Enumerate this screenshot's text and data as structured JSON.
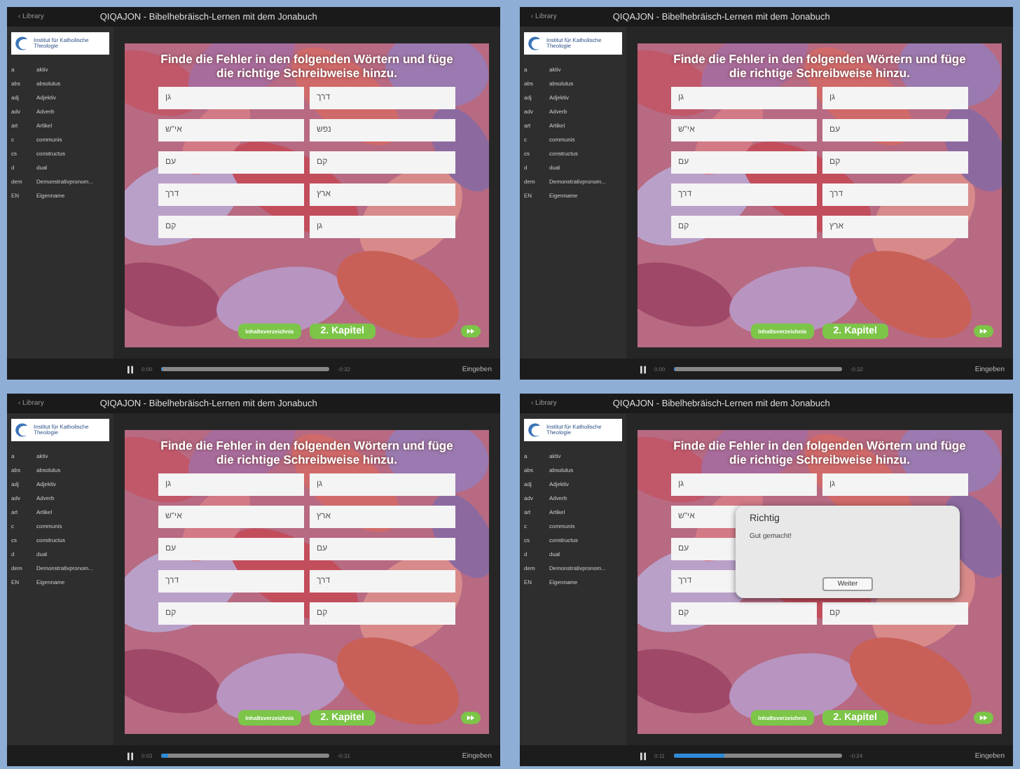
{
  "panels": [
    {
      "back": "‹ Library",
      "title": "QIQAJON - Bibelhebräisch-Lernen mit dem Jonabuch",
      "logo": "Institut für Katholische Theologie",
      "sidebar": [
        {
          "abbr": "a",
          "label": "aktiv"
        },
        {
          "abbr": "abs",
          "label": "absolutus"
        },
        {
          "abbr": "adj",
          "label": "Adjektiv"
        },
        {
          "abbr": "adv",
          "label": "Adverb"
        },
        {
          "abbr": "art",
          "label": "Artikel"
        },
        {
          "abbr": "c",
          "label": "communis"
        },
        {
          "abbr": "cs",
          "label": "constructus"
        },
        {
          "abbr": "d",
          "label": "dual"
        },
        {
          "abbr": "dem",
          "label": "Demonstrativpronom..."
        },
        {
          "abbr": "EN",
          "label": "Eigenname"
        }
      ],
      "heading": "Finde die Fehler in den folgenden Wörtern und füge die richtige Schreibweise hinzu.",
      "rows": [
        {
          "left": "גן",
          "right": "דרך"
        },
        {
          "left": "אי\"ש",
          "right": "נפש"
        },
        {
          "left": "עם",
          "right": "קם"
        },
        {
          "left": "דרך",
          "right": "ארץ"
        },
        {
          "left": "קם",
          "right": "גן"
        }
      ],
      "toc": "Inhaltsverzeichnis",
      "chapter": "2. Kapitel",
      "elapsed": "0:00",
      "remaining": "-0:32",
      "level": 0,
      "enter": "Eingeben"
    },
    {
      "back": "‹ Library",
      "title": "QIQAJON - Bibelhebräisch-Lernen mit dem Jonabuch",
      "logo": "Institut für Katholische Theologie",
      "sidebar": [
        {
          "abbr": "a",
          "label": "aktiv"
        },
        {
          "abbr": "abs",
          "label": "absolutus"
        },
        {
          "abbr": "adj",
          "label": "Adjektiv"
        },
        {
          "abbr": "adv",
          "label": "Adverb"
        },
        {
          "abbr": "art",
          "label": "Artikel"
        },
        {
          "abbr": "c",
          "label": "communis"
        },
        {
          "abbr": "cs",
          "label": "constructus"
        },
        {
          "abbr": "d",
          "label": "dual"
        },
        {
          "abbr": "dem",
          "label": "Demonstrativpronom..."
        },
        {
          "abbr": "EN",
          "label": "Eigenname"
        }
      ],
      "heading": "Finde die Fehler in den folgenden Wörtern und füge die richtige Schreibweise hinzu.",
      "rows": [
        {
          "left": "גן",
          "right": "גן"
        },
        {
          "left": "אי\"ש",
          "right": "עם"
        },
        {
          "left": "עם",
          "right": "קם"
        },
        {
          "left": "דרך",
          "right": "דרך"
        },
        {
          "left": "קם",
          "right": "ארץ"
        }
      ],
      "toc": "Inhaltsverzeichnis",
      "chapter": "2. Kapitel",
      "elapsed": "0:00",
      "remaining": "-0:32",
      "level": 0,
      "enter": "Eingeben"
    },
    {
      "back": "‹ Library",
      "title": "QIQAJON - Bibelhebräisch-Lernen mit dem Jonabuch",
      "logo": "Institut für Katholische Theologie",
      "sidebar": [
        {
          "abbr": "a",
          "label": "aktiv"
        },
        {
          "abbr": "abs",
          "label": "absolutus"
        },
        {
          "abbr": "adj",
          "label": "Adjektiv"
        },
        {
          "abbr": "adv",
          "label": "Adverb"
        },
        {
          "abbr": "art",
          "label": "Artikel"
        },
        {
          "abbr": "c",
          "label": "communis"
        },
        {
          "abbr": "cs",
          "label": "constructus"
        },
        {
          "abbr": "d",
          "label": "dual"
        },
        {
          "abbr": "dem",
          "label": "Demonstrativpronom..."
        },
        {
          "abbr": "EN",
          "label": "Eigenname"
        }
      ],
      "heading": "Finde die Fehler in den folgenden Wörtern und füge die richtige Schreibweise hinzu.",
      "rows": [
        {
          "left": "גן",
          "right": "גן"
        },
        {
          "left": "אי\"ש",
          "right": "ארץ"
        },
        {
          "left": "עם",
          "right": "עם"
        },
        {
          "left": "דרך",
          "right": "דרך"
        },
        {
          "left": "קם",
          "right": "קם"
        }
      ],
      "toc": "Inhaltsverzeichnis",
      "chapter": "2. Kapitel",
      "elapsed": "0:03",
      "remaining": "-0:31",
      "level": 0.04,
      "enter": "Eingeben"
    },
    {
      "back": "‹ Library",
      "title": "QIQAJON - Bibelhebräisch-Lernen mit dem Jonabuch",
      "logo": "Institut für Katholische Theologie",
      "sidebar": [
        {
          "abbr": "a",
          "label": "aktiv"
        },
        {
          "abbr": "abs",
          "label": "absolutus"
        },
        {
          "abbr": "adj",
          "label": "Adjektiv"
        },
        {
          "abbr": "adv",
          "label": "Adverb"
        },
        {
          "abbr": "art",
          "label": "Artikel"
        },
        {
          "abbr": "c",
          "label": "communis"
        },
        {
          "abbr": "cs",
          "label": "constructus"
        },
        {
          "abbr": "d",
          "label": "dual"
        },
        {
          "abbr": "dem",
          "label": "Demonstrativpronom..."
        },
        {
          "abbr": "EN",
          "label": "Eigenname"
        }
      ],
      "heading": "Finde die Fehler in den folgenden Wörtern und füge die richtige Schreibweise hinzu.",
      "rows": [
        {
          "left": "גן",
          "right": "גן"
        },
        {
          "left": "אי\"ש"
        },
        {
          "left": "עם"
        },
        {
          "left": "דרך"
        },
        {
          "left": "קם",
          "right": "קם"
        }
      ],
      "dialog": {
        "title": "Richtig",
        "message": "Gut gemacht!",
        "button": "Weiter"
      },
      "toc": "Inhaltsverzeichnis",
      "chapter": "2. Kapitel",
      "elapsed": "0:11",
      "remaining": "-0:24",
      "level": 0.3,
      "enter": "Eingeben"
    }
  ]
}
